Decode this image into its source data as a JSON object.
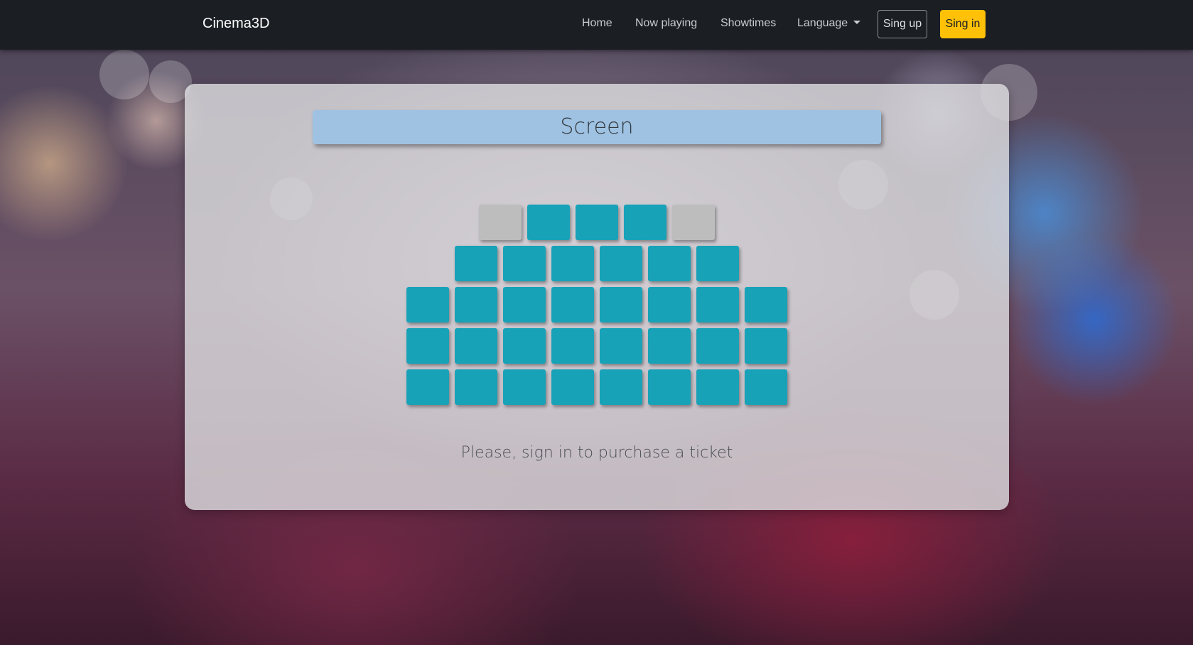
{
  "navbar": {
    "brand": "Cinema3D",
    "links": [
      "Home",
      "Now playing",
      "Showtimes"
    ],
    "language_label": "Language",
    "signup_label": "Sing up",
    "signin_label": "Sing in"
  },
  "hall": {
    "screen_label": "Screen",
    "rows": [
      [
        "taken",
        "free",
        "free",
        "free",
        "taken"
      ],
      [
        "free",
        "free",
        "free",
        "free",
        "free",
        "free"
      ],
      [
        "free",
        "free",
        "free",
        "free",
        "free",
        "free",
        "free",
        "free"
      ],
      [
        "free",
        "free",
        "free",
        "free",
        "free",
        "free",
        "free",
        "free"
      ],
      [
        "free",
        "free",
        "free",
        "free",
        "free",
        "free",
        "free",
        "free"
      ]
    ],
    "message": "Please, sign in to purchase a ticket"
  },
  "colors": {
    "navbar_bg": "#1b1f23",
    "seat_free": "#17a2b8",
    "seat_taken": "#bdbdbd",
    "signin_button": "#ffc107",
    "screen": "#9fc2e2"
  }
}
